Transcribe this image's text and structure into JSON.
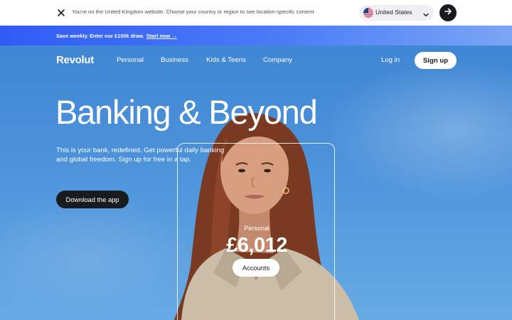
{
  "notice": {
    "message": "You're on the United Kingdom website. Choose your country or region to see location-specific content",
    "country": "United States",
    "icons": {
      "close": "close-icon",
      "flag": "us-flag-icon",
      "chevron": "chevron-down-icon",
      "go": "arrow-right-icon"
    }
  },
  "promo": {
    "text": "Save weekly. Enter our £100k draw.",
    "link": "Start now →"
  },
  "nav": {
    "logo": "Revolut",
    "items": [
      "Personal",
      "Business",
      "Kids & Teens",
      "Company"
    ],
    "login": "Log in",
    "signup": "Sign up"
  },
  "hero": {
    "headline": "Banking & Beyond",
    "subtitle": "This is your bank, redefined. Get powerful daily banking and global freedom. Sign up for free in a tap.",
    "cta": "Download the app"
  },
  "card": {
    "label": "Personal",
    "amount": "£6,012",
    "button": "Accounts"
  },
  "colors": {
    "dark": "#191c1f",
    "promo_start": "#2f5cf5",
    "promo_end": "#7aa6f5",
    "sky": "#4c92da"
  }
}
